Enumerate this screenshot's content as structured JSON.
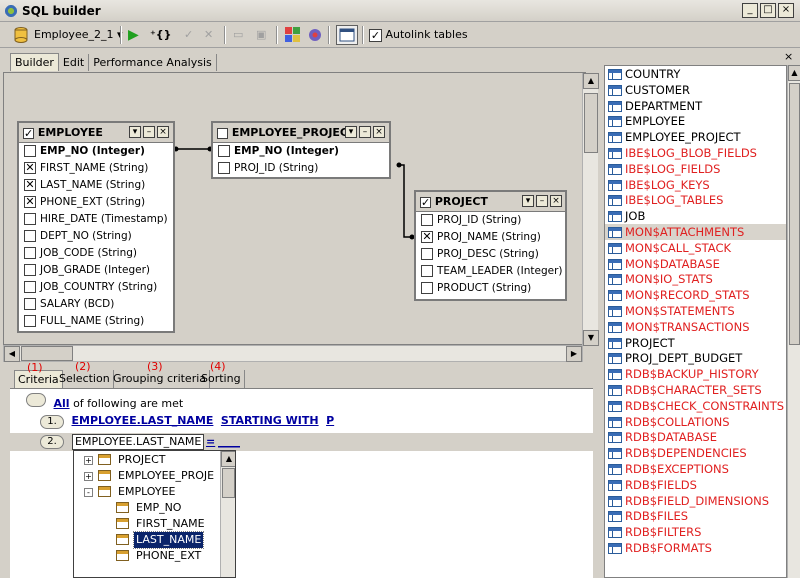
{
  "window": {
    "title": "SQL builder",
    "min": "_",
    "max": "□",
    "close": "×"
  },
  "toolbar": {
    "db_select": "Employee_2_1",
    "autolink_label": "Autolink tables",
    "autolink_checked": true
  },
  "tabs": [
    "Builder",
    "Edit",
    "Performance Analysis"
  ],
  "tables": {
    "employee": {
      "name": "EMPLOYEE",
      "checked": true,
      "fields": [
        {
          "label": "EMP_NO (Integer)",
          "checked": false,
          "bold": true
        },
        {
          "label": "FIRST_NAME (String)",
          "checked": true
        },
        {
          "label": "LAST_NAME (String)",
          "checked": true
        },
        {
          "label": "PHONE_EXT (String)",
          "checked": true
        },
        {
          "label": "HIRE_DATE (Timestamp)",
          "checked": false
        },
        {
          "label": "DEPT_NO (String)",
          "checked": false
        },
        {
          "label": "JOB_CODE (String)",
          "checked": false
        },
        {
          "label": "JOB_GRADE (Integer)",
          "checked": false
        },
        {
          "label": "JOB_COUNTRY (String)",
          "checked": false
        },
        {
          "label": "SALARY (BCD)",
          "checked": false
        },
        {
          "label": "FULL_NAME (String)",
          "checked": false
        }
      ]
    },
    "employee_project": {
      "name": "EMPLOYEE_PROJECT",
      "checked": false,
      "fields": [
        {
          "label": "EMP_NO (Integer)",
          "checked": false,
          "bold": true
        },
        {
          "label": "PROJ_ID (String)",
          "checked": false
        }
      ]
    },
    "project": {
      "name": "PROJECT",
      "checked": true,
      "fields": [
        {
          "label": "PROJ_ID (String)",
          "checked": false
        },
        {
          "label": "PROJ_NAME (String)",
          "checked": true
        },
        {
          "label": "PROJ_DESC (String)",
          "checked": false
        },
        {
          "label": "TEAM_LEADER (Integer)",
          "checked": false
        },
        {
          "label": "PRODUCT (String)",
          "checked": false
        }
      ]
    }
  },
  "criteria_tabs": [
    {
      "num": "(1)",
      "label": "Criteria"
    },
    {
      "num": "(2)",
      "label": "Selection"
    },
    {
      "num": "(3)",
      "label": "Grouping criteria"
    },
    {
      "num": "(4)",
      "label": "Sorting"
    }
  ],
  "criteria": {
    "all_link": "All",
    "all_text": "of following are met",
    "c1_num": "1.",
    "c1_field": "EMPLOYEE.LAST_NAME",
    "c1_op": "STARTING WITH",
    "c1_value": "P",
    "c2_num": "2.",
    "c2_field": "EMPLOYEE.LAST_NAME",
    "c2_op": "=",
    "c2_value": "____"
  },
  "tree": [
    {
      "label": "PROJECT",
      "level": 0,
      "expander": "+"
    },
    {
      "label": "EMPLOYEE_PROJE",
      "level": 0,
      "expander": "+"
    },
    {
      "label": "EMPLOYEE",
      "level": 0,
      "expander": "-"
    },
    {
      "label": "EMP_NO",
      "level": 1
    },
    {
      "label": "FIRST_NAME",
      "level": 1
    },
    {
      "label": "LAST_NAME",
      "level": 1,
      "selected": true
    },
    {
      "label": "PHONE_EXT",
      "level": 1
    }
  ],
  "right_list": [
    {
      "label": "COUNTRY",
      "sys": false
    },
    {
      "label": "CUSTOMER",
      "sys": false
    },
    {
      "label": "DEPARTMENT",
      "sys": false
    },
    {
      "label": "EMPLOYEE",
      "sys": false
    },
    {
      "label": "EMPLOYEE_PROJECT",
      "sys": false
    },
    {
      "label": "IBE$LOG_BLOB_FIELDS",
      "sys": true
    },
    {
      "label": "IBE$LOG_FIELDS",
      "sys": true
    },
    {
      "label": "IBE$LOG_KEYS",
      "sys": true
    },
    {
      "label": "IBE$LOG_TABLES",
      "sys": true
    },
    {
      "label": "JOB",
      "sys": false
    },
    {
      "label": "MON$ATTACHMENTS",
      "sys": true,
      "selected": true
    },
    {
      "label": "MON$CALL_STACK",
      "sys": true
    },
    {
      "label": "MON$DATABASE",
      "sys": true
    },
    {
      "label": "MON$IO_STATS",
      "sys": true
    },
    {
      "label": "MON$RECORD_STATS",
      "sys": true
    },
    {
      "label": "MON$STATEMENTS",
      "sys": true
    },
    {
      "label": "MON$TRANSACTIONS",
      "sys": true
    },
    {
      "label": "PROJECT",
      "sys": false
    },
    {
      "label": "PROJ_DEPT_BUDGET",
      "sys": false
    },
    {
      "label": "RDB$BACKUP_HISTORY",
      "sys": true
    },
    {
      "label": "RDB$CHARACTER_SETS",
      "sys": true
    },
    {
      "label": "RDB$CHECK_CONSTRAINTS",
      "sys": true
    },
    {
      "label": "RDB$COLLATIONS",
      "sys": true
    },
    {
      "label": "RDB$DATABASE",
      "sys": true
    },
    {
      "label": "RDB$DEPENDENCIES",
      "sys": true
    },
    {
      "label": "RDB$EXCEPTIONS",
      "sys": true
    },
    {
      "label": "RDB$FIELDS",
      "sys": true
    },
    {
      "label": "RDB$FIELD_DIMENSIONS",
      "sys": true
    },
    {
      "label": "RDB$FILES",
      "sys": true
    },
    {
      "label": "RDB$FILTERS",
      "sys": true
    },
    {
      "label": "RDB$FORMATS",
      "sys": true
    }
  ],
  "colors": {
    "system_table": "#e02020",
    "link": "#0000a0",
    "tab_number": "#e00000"
  }
}
